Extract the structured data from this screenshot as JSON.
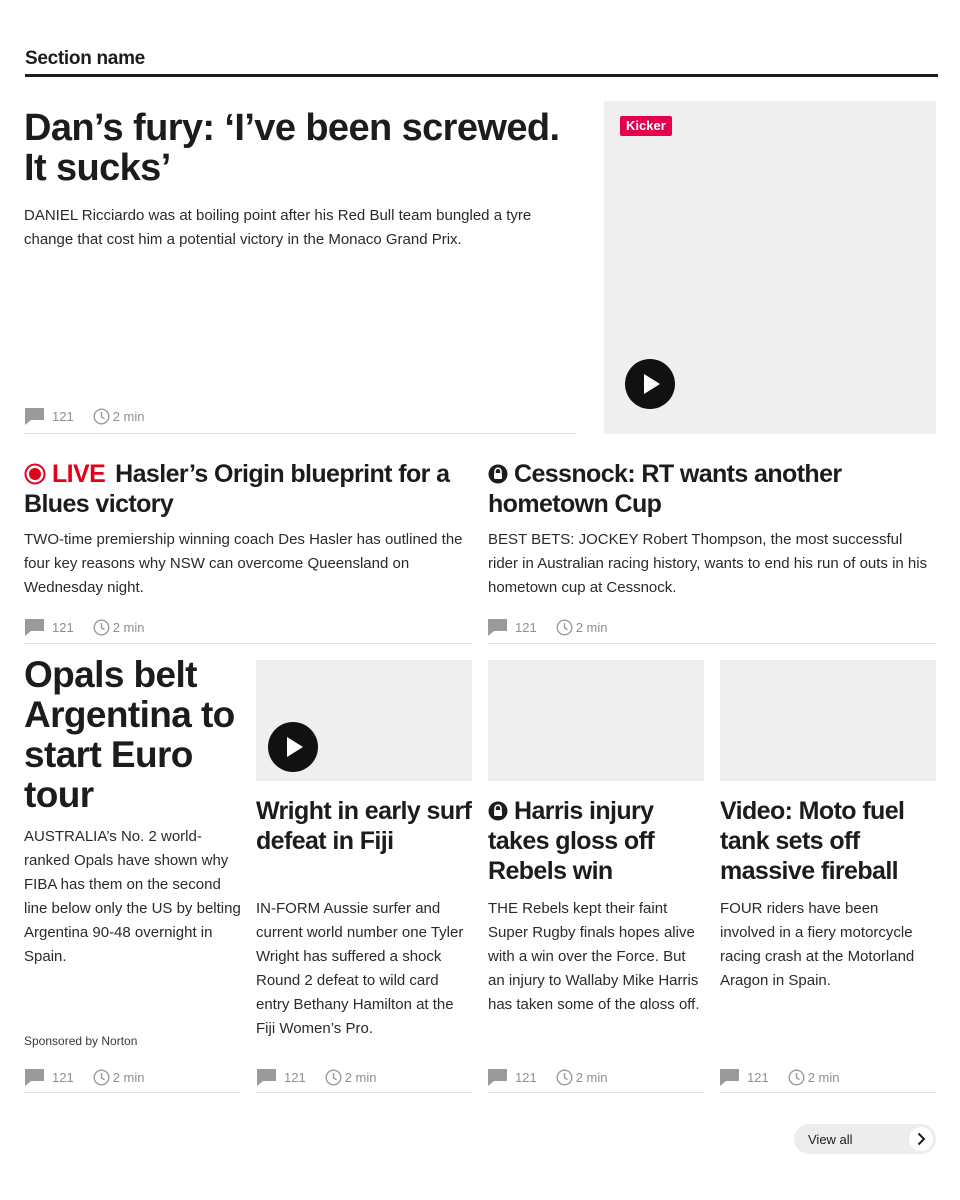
{
  "section": {
    "name": "Section name"
  },
  "lead": {
    "headline": "Dan’s fury: ‘I’ve been screwed. It sucks’",
    "standfirst": "DANIEL Ricciardo was at boiling point after his Red Bull team bungled a tyre change that cost him a potential victory in the Monaco Grand Prix.",
    "kicker": "Kicker",
    "comments": "121",
    "read_time": "2 min"
  },
  "row2": [
    {
      "live_label": "LIVE",
      "headline": "Hasler’s Origin blueprint for a Blues victory",
      "standfirst": "TWO-time premiership winning coach Des Hasler has outlined the four key reasons why NSW can overcome Queensland on Wednesday night.",
      "comments": "121",
      "read_time": "2 min"
    },
    {
      "headline": "Cessnock: RT wants another hometown Cup",
      "standfirst": "BEST BETS: JOCKEY Robert Thompson, the most successful rider in Australian racing history, wants to end his run of outs in his hometown cup at Cessnock.",
      "comments": "121",
      "read_time": "2 min"
    }
  ],
  "row3": [
    {
      "headline": "Opals belt Argentina to start Euro tour",
      "standfirst": "AUSTRALIA’s No. 2 world-ranked Opals have shown why FIBA has them on the second line below only the US by belting Argentina 90-48 overnight in Spain.",
      "sponsored": "Sponsored by Norton",
      "comments": "121",
      "read_time": "2 min"
    },
    {
      "headline": "Wright in early surf defeat in Fiji",
      "standfirst": "IN-FORM Aussie surfer and current world number one Tyler Wright has suffered a shock Round 2 defeat to wild card entry Bethany Hamilton at the Fiji Women’s Pro.",
      "comments": "121",
      "read_time": "2 min"
    },
    {
      "headline": "Harris injury takes gloss off Rebels win",
      "standfirst": "THE Rebels kept their faint Super Rugby finals hopes alive with a win over the Force. But an injury to Wallaby Mike Harris has taken some of the gloss off.",
      "comments": "121",
      "read_time": "2 min"
    },
    {
      "headline": "Video: Moto fuel tank sets off massive fireball",
      "standfirst": "FOUR riders have been involved in a fiery motorcycle racing crash at the Motorland Aragon in Spain.",
      "comments": "121",
      "read_time": "2 min"
    }
  ],
  "footer": {
    "view_all": "View all"
  },
  "colors": {
    "live_red": "#e3001b",
    "kicker_pink": "#e5004b",
    "text": "#1c1c1c",
    "meta_grey": "#8f8f8f",
    "placeholder": "#efefef"
  },
  "icons": {
    "comments": "comment-icon",
    "time": "clock-icon",
    "video": "play-icon",
    "premium": "lock-icon",
    "live": "live-dot-icon",
    "more": "chevron-right-icon"
  }
}
